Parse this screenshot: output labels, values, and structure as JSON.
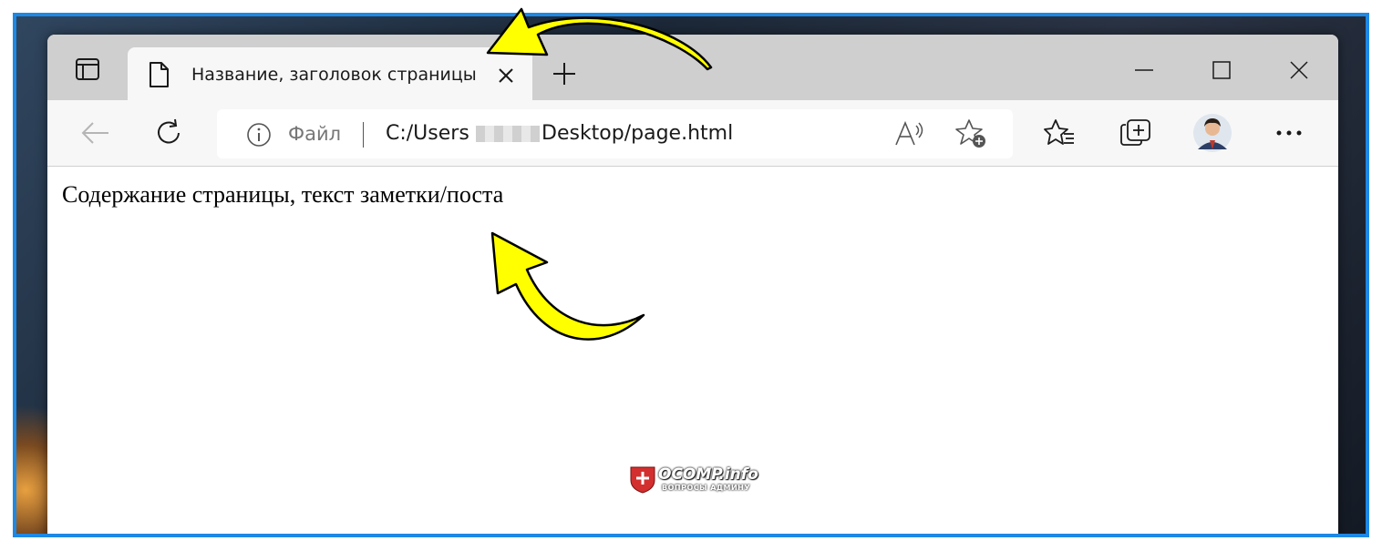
{
  "tab": {
    "title": "Название, заголовок страницы"
  },
  "addressbar": {
    "site_label": "Файл",
    "url_prefix": "C:/Users",
    "url_suffix": "Desktop/page.html"
  },
  "page": {
    "content_text": "Содержание страницы, текст заметки/поста"
  },
  "watermark": {
    "name": "OCOMP.info",
    "subtitle": "ВОПРОСЫ АДМИНУ"
  },
  "icons": {
    "tab_actions": "tab-actions-icon",
    "page": "page-icon",
    "close": "close-icon",
    "new_tab": "plus-icon",
    "minimize": "minimize-icon",
    "maximize": "maximize-icon",
    "window_close": "window-close-icon",
    "back": "back-arrow-icon",
    "refresh": "refresh-icon",
    "info": "info-icon",
    "read_aloud": "read-aloud-icon",
    "add_favorite": "star-add-icon",
    "favorites": "favorites-icon",
    "collections": "collections-icon",
    "profile": "avatar",
    "more": "more-icon"
  },
  "colors": {
    "frame_border": "#1e88e5",
    "annotation_arrow": "#ffff00",
    "tabstrip": "#cfcfcf",
    "toolbar": "#f7f7f7"
  }
}
